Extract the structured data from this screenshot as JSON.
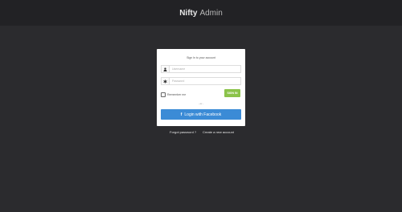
{
  "header": {
    "brand_bold": "Nifty",
    "brand_light": "Admin"
  },
  "login": {
    "title": "Sign In to your account",
    "username": {
      "placeholder": "Username",
      "icon": "user-icon"
    },
    "password": {
      "placeholder": "Password",
      "icon": "asterisk-icon"
    },
    "remember_label": "Remember me",
    "signin_label": "SIGN IN",
    "separator": "- or -",
    "facebook_icon": "f",
    "facebook_label": "Login with Facebook"
  },
  "footer_links": {
    "forgot": "Forgot password ?",
    "create": "Create a new account"
  },
  "colors": {
    "background": "#2b2b2e",
    "topbar": "#222225",
    "signin": "#8bc34a",
    "facebook": "#3b8bd6"
  }
}
